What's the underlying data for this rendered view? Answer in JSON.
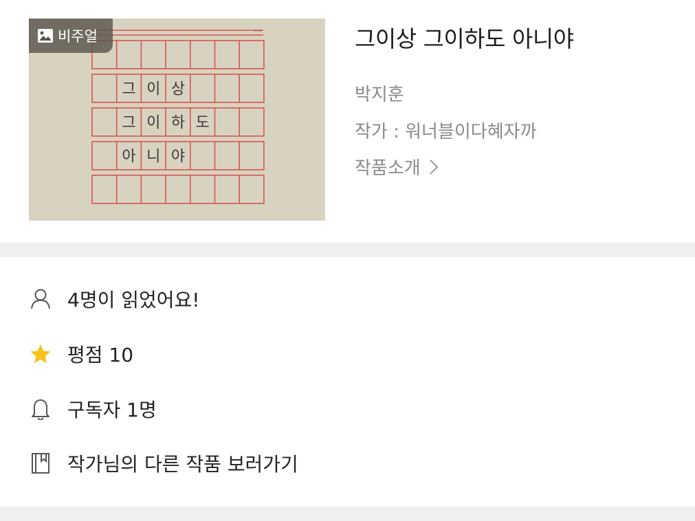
{
  "thumbnail": {
    "badge_label": "비주얼",
    "badge_icon": "image-icon",
    "handwriting": [
      "그",
      "이",
      "상",
      "그",
      "이",
      "하",
      "도",
      "아",
      "니",
      "야"
    ],
    "paper_color": "#d8d3c0",
    "grid_color": "#d9534f"
  },
  "work": {
    "title": "그이상 그이하도 아니야",
    "author_name": "박지훈",
    "writer_line": "작가 : 워너블이다혜자까",
    "intro_label": "작품소개"
  },
  "stats": {
    "readers": {
      "icon": "person-icon",
      "label": "4명이 읽었어요!"
    },
    "rating": {
      "icon": "star-icon",
      "label": "평점 10",
      "star_color": "#f7c21a"
    },
    "subscribers": {
      "icon": "bell-icon",
      "label": "구독자 1명"
    },
    "other_works": {
      "icon": "book-icon",
      "label": "작가님의 다른 작품 보러가기"
    }
  }
}
